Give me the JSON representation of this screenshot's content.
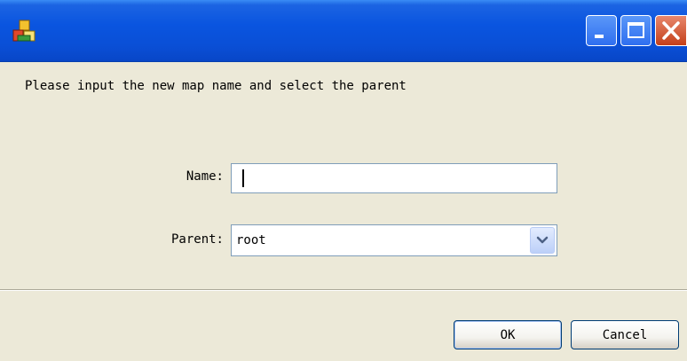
{
  "window": {
    "title": "",
    "icon": "app-icon",
    "controls": [
      "minimize-icon",
      "maximize-icon",
      "close-icon"
    ]
  },
  "dialog": {
    "prompt": "Please input the new map name and select the parent",
    "name_label": "Name:",
    "name_value": "",
    "parent_label": "Parent:",
    "parent_value": "root",
    "ok_label": "OK",
    "cancel_label": "Cancel"
  },
  "colors": {
    "titlebar": "#0a55e0",
    "background": "#ece9d8",
    "close_button": "#c4401a",
    "input_border": "#7f9db9"
  }
}
